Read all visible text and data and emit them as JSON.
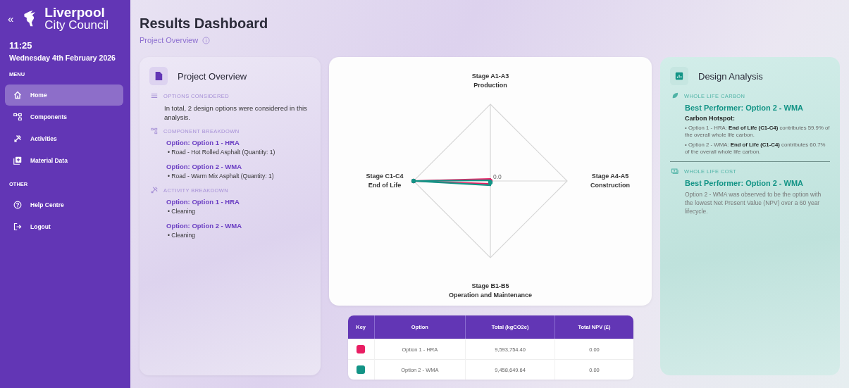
{
  "sidebar": {
    "collapse": "«",
    "logo": {
      "line1": "Liverpool",
      "line2": "City Council"
    },
    "time": "11:25",
    "date": "Wednesday 4th February 2026",
    "sections": [
      {
        "heading": "MENU",
        "items": [
          {
            "label": "Home",
            "selected": true
          },
          {
            "label": "Components",
            "selected": false
          },
          {
            "label": "Activities",
            "selected": false
          },
          {
            "label": "Material Data",
            "selected": false
          }
        ]
      },
      {
        "heading": "OTHER",
        "items": [
          {
            "label": "Help Centre",
            "selected": false
          },
          {
            "label": "Logout",
            "selected": false
          }
        ]
      }
    ]
  },
  "header": {
    "title": "Results Dashboard",
    "subtitle": "Project Overview"
  },
  "overview": {
    "title": "Project Overview",
    "sections": [
      {
        "kind": "text",
        "heading": "OPTIONS CONSIDERED",
        "text": "In total, 2 design options were considered in this analysis."
      },
      {
        "kind": "options",
        "heading": "COMPONENT BREAKDOWN",
        "options": [
          {
            "name": "Option: Option 1 - HRA",
            "items": [
              "• Road - Hot Rolled Asphalt (Quantity: 1)"
            ]
          },
          {
            "name": "Option: Option 2 - WMA",
            "items": [
              "• Road - Warm Mix Asphalt (Quantity: 1)"
            ]
          }
        ]
      },
      {
        "kind": "options",
        "heading": "ACTIVITY BREAKDOWN",
        "options": [
          {
            "name": "Option: Option 1 - HRA",
            "items": [
              "• Cleaning"
            ]
          },
          {
            "name": "Option: Option 2 - WMA",
            "items": [
              "• Cleaning"
            ]
          }
        ]
      }
    ]
  },
  "chart": {
    "axes": [
      {
        "line1": "Stage A1-A3",
        "line2": "Production"
      },
      {
        "line1": "Stage A4-A5",
        "line2": "Construction"
      },
      {
        "line1": "Stage B1-B5",
        "line2": "Operation and Maintenance"
      },
      {
        "line1": "Stage C1-C4",
        "line2": "End of Life"
      }
    ],
    "tick": "0.0"
  },
  "table": {
    "columns": [
      "Key",
      "Option",
      "Total (kgCO2e)",
      "Total NPV (£)"
    ],
    "rows": [
      {
        "color": "#e91e63",
        "option": "Option 1 - HRA",
        "total": "9,593,754.40",
        "npv": "0.00"
      },
      {
        "color": "#139486",
        "option": "Option 2 - WMA",
        "total": "9,458,649.64",
        "npv": "0.00"
      }
    ]
  },
  "analysis": {
    "title": "Design Analysis",
    "sections": [
      {
        "kind": "carbon",
        "heading": "WHOLE LIFE CARBON",
        "best": "Best Performer: Option 2 - WMA",
        "label": "Carbon Hotspot:",
        "notes": [
          "• Option 1 - HRA: **End of Life (C1-C4)** contributes 59.9% of the overall whole life carbon.",
          "• Option 2 - WMA: **End of Life (C1-C4)** contributes 60.7% of the overall whole life carbon."
        ]
      },
      {
        "kind": "cost",
        "heading": "WHOLE LIFE COST",
        "best": "Best Performer: Option 2 - WMA",
        "text": "Option 2 - WMA was observed to be the option with the lowest Net Present Value (NPV) over a 60 year lifecycle."
      }
    ]
  }
}
